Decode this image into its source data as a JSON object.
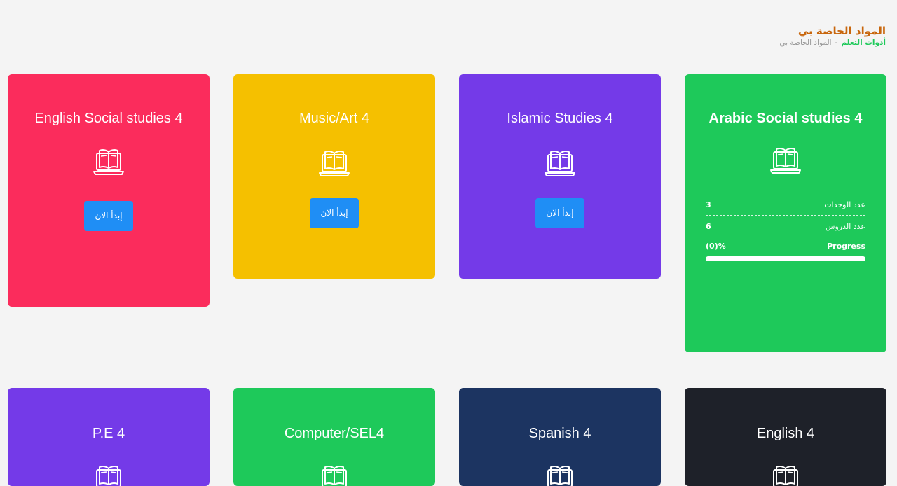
{
  "header": {
    "title": "المواد الخاصة بي",
    "breadcrumb_root": "أدوات التعلم",
    "breadcrumb_sep": "-",
    "breadcrumb_current": "المواد الخاصة بي"
  },
  "start_label": "إبدأ الان",
  "cards": [
    {
      "title": "Arabic Social studies 4",
      "color": "#1ec95a"
    },
    {
      "title": "Islamic Studies 4",
      "color": "#743ae8"
    },
    {
      "title": "Music/Art 4",
      "color": "#f5c000"
    },
    {
      "title": "English Social studies 4",
      "color": "#fb2c5c"
    },
    {
      "title": "English 4",
      "color": "#1e2129"
    },
    {
      "title": "Spanish 4",
      "color": "#1c3461"
    },
    {
      "title": "Computer/SEL4",
      "color": "#1ec95a"
    },
    {
      "title": "P.E 4",
      "color": "#743ae8"
    }
  ],
  "stats": {
    "units_label": "عدد الوحدات",
    "units_value": "3",
    "lessons_label": "عدد الدروس",
    "lessons_value": "6",
    "progress_label": "Progress",
    "progress_value": "%(0)",
    "progress_fraction": 0
  },
  "icons": {
    "book": "book-laptop-icon"
  }
}
